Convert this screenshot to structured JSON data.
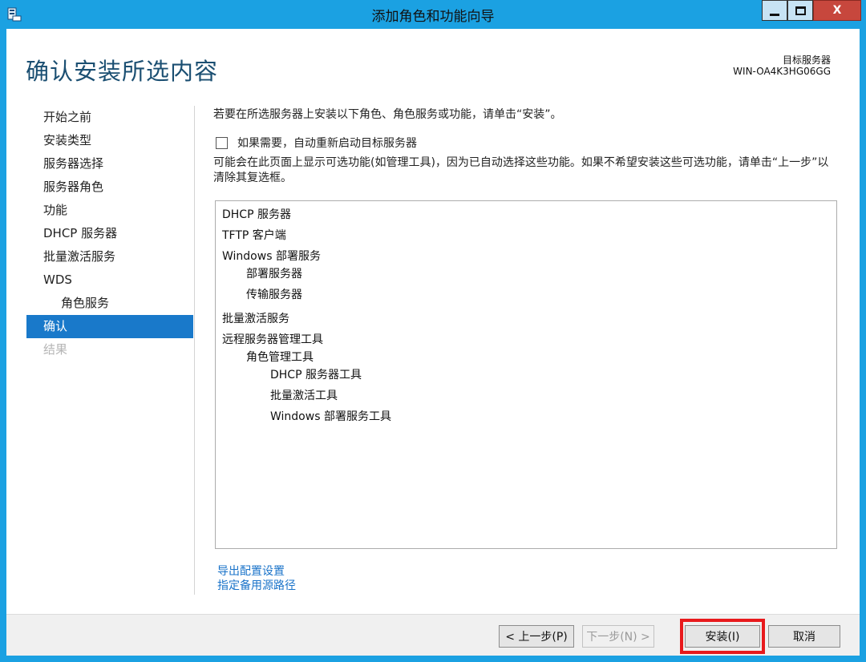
{
  "window": {
    "title": "添加角色和功能向导",
    "close_glyph": "X"
  },
  "header": {
    "page_title": "确认安装所选内容",
    "target_label": "目标服务器",
    "target_value": "WIN-OA4K3HG06GG"
  },
  "nav": {
    "items": [
      {
        "label": "开始之前"
      },
      {
        "label": "安装类型"
      },
      {
        "label": "服务器选择"
      },
      {
        "label": "服务器角色"
      },
      {
        "label": "功能"
      },
      {
        "label": "DHCP 服务器"
      },
      {
        "label": "批量激活服务"
      },
      {
        "label": "WDS"
      },
      {
        "label": "角色服务"
      },
      {
        "label": "确认"
      },
      {
        "label": "结果"
      }
    ]
  },
  "content": {
    "intro": "若要在所选服务器上安装以下角色、角色服务或功能，请单击“安装”。",
    "restart_checkbox_label": "如果需要，自动重新启动目标服务器",
    "note": "可能会在此页面上显示可选功能(如管理工具)，因为已自动选择这些功能。如果不希望安装这些可选功能，请单击“上一步”以清除其复选框。",
    "selection": [
      "DHCP 服务器",
      "TFTP 客户端",
      "Windows 部署服务",
      "部署服务器",
      "传输服务器",
      "批量激活服务",
      "远程服务器管理工具",
      "角色管理工具",
      "DHCP 服务器工具",
      "批量激活工具",
      "Windows 部署服务工具"
    ],
    "links": {
      "export": "导出配置设置",
      "alternate_source": "指定备用源路径"
    }
  },
  "footer": {
    "prev": "< 上一步(P)",
    "next": "下一步(N) >",
    "install": "安装(I)",
    "cancel": "取消",
    "highlight_color": "#e8191c"
  }
}
